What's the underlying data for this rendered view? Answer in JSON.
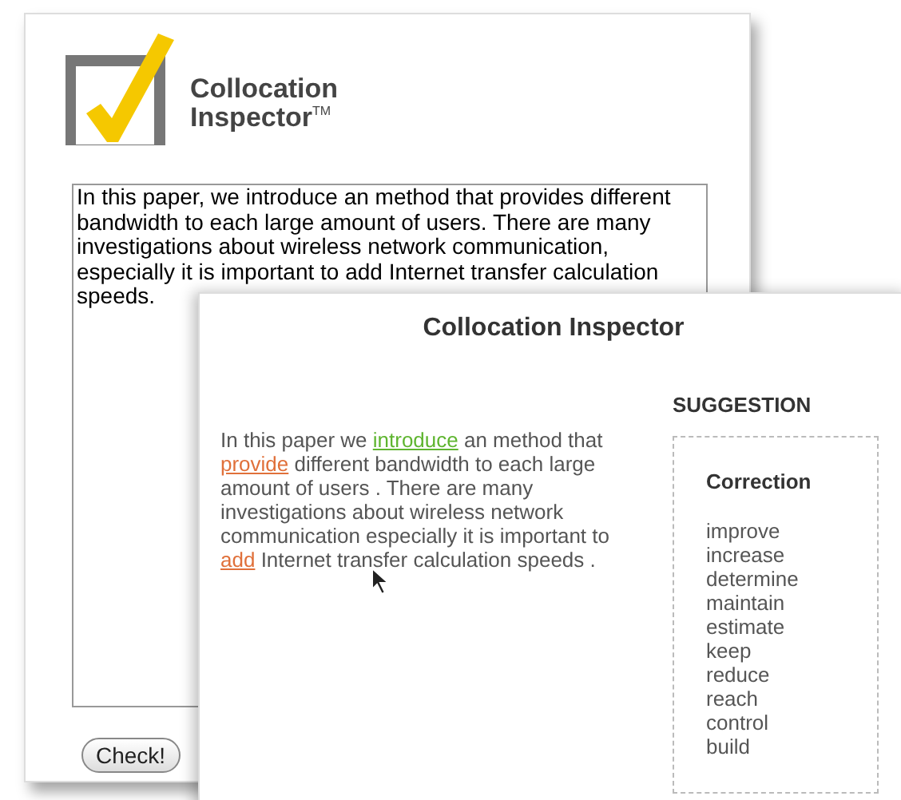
{
  "back_window": {
    "logo": {
      "line1": "Collocation",
      "line2": "Inspector",
      "trademark": "TM"
    },
    "input_text": "In this paper, we introduce an method that provides different bandwidth to each large amount of users. There are many investigations about wireless network communication, especially it is important to add Internet transfer calculation speeds.",
    "check_button": "Check!"
  },
  "front_window": {
    "title": "Collocation Inspector",
    "paragraph": [
      {
        "kind": "text",
        "text": "In this paper we "
      },
      {
        "kind": "good",
        "text": "introduce"
      },
      {
        "kind": "text",
        "text": " an method that "
      },
      {
        "kind": "flagged",
        "text": "provide"
      },
      {
        "kind": "text",
        "text": " different bandwidth to each large amount of users . There are many investigations about wireless network communication especially it is important to "
      },
      {
        "kind": "flagged",
        "text": "add"
      },
      {
        "kind": "text",
        "text": " Internet transfer calculation speeds ."
      }
    ],
    "suggestion_heading": "SUGGESTION",
    "correction_heading": "Correction",
    "corrections": [
      "improve",
      "increase",
      "determine",
      "maintain",
      "estimate",
      "keep",
      "reduce",
      "reach",
      "control",
      "build"
    ]
  }
}
